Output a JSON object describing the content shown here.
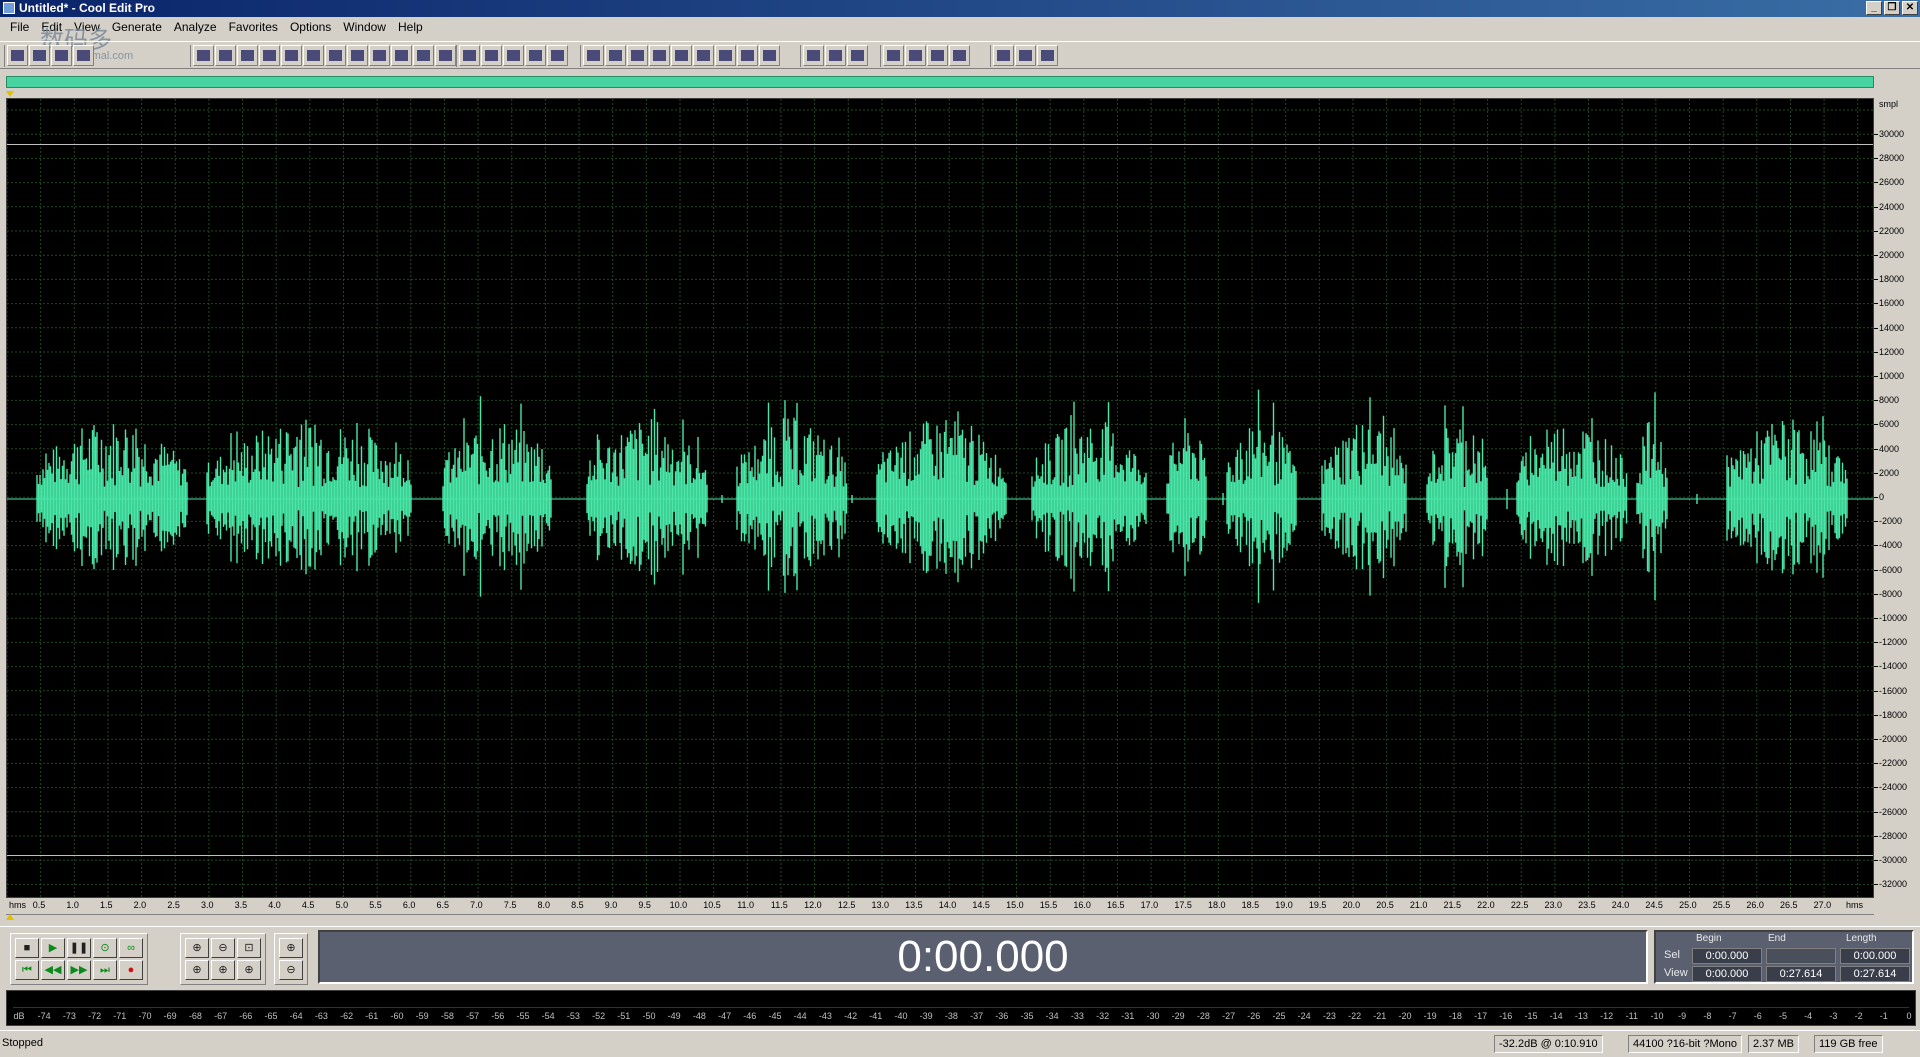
{
  "window": {
    "title": "Untitled* - Cool Edit Pro"
  },
  "watermark": {
    "text": "数码多",
    "sub": "Soomal.com"
  },
  "menu": [
    "File",
    "Edit",
    "View",
    "Generate",
    "Analyze",
    "Favorites",
    "Options",
    "Window",
    "Help"
  ],
  "colors": {
    "waveform": "#48e8a8",
    "background": "#000000",
    "grid": "#1d4a1d",
    "display": "#5a6070"
  },
  "y_axis": {
    "unit": "smpl",
    "labels": [
      "30000",
      "28000",
      "26000",
      "24000",
      "22000",
      "20000",
      "18000",
      "16000",
      "14000",
      "12000",
      "10000",
      "8000",
      "6000",
      "4000",
      "2000",
      "0",
      "-2000",
      "-4000",
      "-6000",
      "-8000",
      "-10000",
      "-12000",
      "-14000",
      "-16000",
      "-18000",
      "-20000",
      "-22000",
      "-24000",
      "-26000",
      "-28000",
      "-30000",
      "-32000"
    ]
  },
  "x_axis": {
    "unit_left": "hms",
    "unit_right": "hms",
    "labels": [
      "0.5",
      "1.0",
      "1.5",
      "2.0",
      "2.5",
      "3.0",
      "3.5",
      "4.0",
      "4.5",
      "5.0",
      "5.5",
      "6.0",
      "6.5",
      "7.0",
      "7.5",
      "8.0",
      "8.5",
      "9.0",
      "9.5",
      "10.0",
      "10.5",
      "11.0",
      "11.5",
      "12.0",
      "12.5",
      "13.0",
      "13.5",
      "14.0",
      "14.5",
      "15.0",
      "15.5",
      "16.0",
      "16.5",
      "17.0",
      "17.5",
      "18.0",
      "18.5",
      "19.0",
      "19.5",
      "20.0",
      "20.5",
      "21.0",
      "21.5",
      "22.0",
      "22.5",
      "23.0",
      "23.5",
      "24.0",
      "24.5",
      "25.0",
      "25.5",
      "26.0",
      "26.5",
      "27.0"
    ]
  },
  "transport": {
    "time": "0:00.000"
  },
  "selection": {
    "headers": [
      "Begin",
      "End",
      "Length"
    ],
    "sel_label": "Sel",
    "view_label": "View",
    "sel_begin": "0:00.000",
    "sel_end": "",
    "sel_length": "0:00.000",
    "view_begin": "0:00.000",
    "view_end": "0:27.614",
    "view_length": "0:27.614"
  },
  "meter": {
    "labels": [
      "dB",
      "-74",
      "-73",
      "-72",
      "-71",
      "-70",
      "-69",
      "-68",
      "-67",
      "-66",
      "-65",
      "-64",
      "-63",
      "-62",
      "-61",
      "-60",
      "-59",
      "-58",
      "-57",
      "-56",
      "-55",
      "-54",
      "-53",
      "-52",
      "-51",
      "-50",
      "-49",
      "-48",
      "-47",
      "-46",
      "-45",
      "-44",
      "-43",
      "-42",
      "-41",
      "-40",
      "-39",
      "-38",
      "-37",
      "-36",
      "-35",
      "-34",
      "-33",
      "-32",
      "-31",
      "-30",
      "-29",
      "-28",
      "-27",
      "-26",
      "-25",
      "-24",
      "-23",
      "-22",
      "-21",
      "-20",
      "-19",
      "-18",
      "-17",
      "-16",
      "-15",
      "-14",
      "-13",
      "-12",
      "-11",
      "-10",
      "-9",
      "-8",
      "-7",
      "-6",
      "-5",
      "-4",
      "-3",
      "-2",
      "-1",
      "0"
    ]
  },
  "status": {
    "state": "Stopped",
    "level": "-32.2dB @  0:10.910",
    "format": "44100 ?16-bit ?Mono",
    "size": "2.37 MB",
    "free": "119 GB free"
  }
}
